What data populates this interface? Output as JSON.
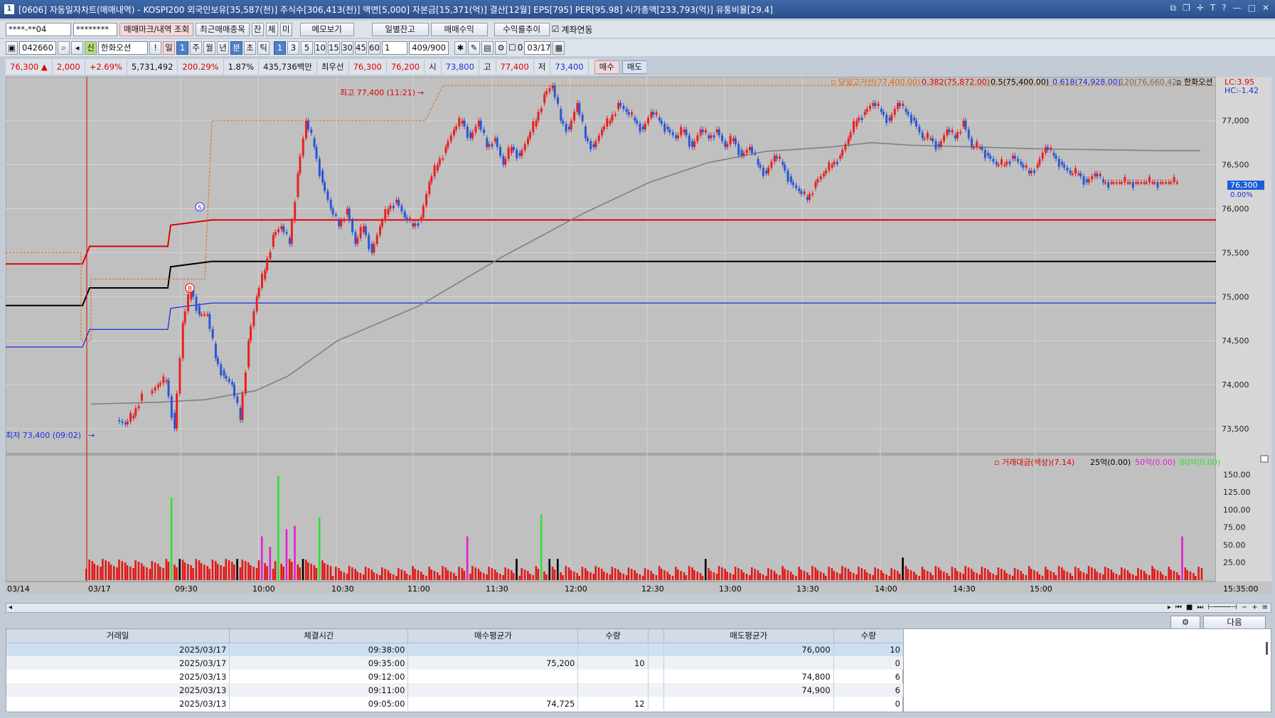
{
  "window": {
    "num": "1",
    "title": "[0606] 자동일자차트(매매내역) - KOSPI200 외국인보유[35,587(천)] 주식수[306,413(천)] 액면[5,000] 자본금[15,371(억)] 결산[12월] EPS[795] PER[95.98] 시가총액[233,793(억)] 유통비율[29.4]"
  },
  "toolbar1": {
    "account": "****-**04",
    "password": "********",
    "btn_mark": "매매마크/내역 조회",
    "btn_recent": "최근매매종목",
    "btn_jan": "잔",
    "btn_che": "체",
    "btn_mi": "미",
    "btn_memo": "메모보기",
    "btn_daily": "일별잔고",
    "btn_profit": "매매수익",
    "btn_profit_trend": "수익률추이",
    "chk_link": "계좌연동"
  },
  "toolbar2": {
    "code": "042660",
    "stock_badge": "신",
    "stock": "한화오션",
    "periods": [
      "일",
      "1",
      "주",
      "월",
      "년",
      "분",
      "초",
      "틱"
    ],
    "minutes": [
      "1",
      "3",
      "5",
      "10",
      "15",
      "30",
      "45",
      "60"
    ],
    "num": "1",
    "count": "409/900",
    "date": "03/17",
    "chk_zero": "0"
  },
  "pricebar": {
    "price": "76,300",
    "arrow": "▲",
    "change": "2,000",
    "rate": "+2.69%",
    "volume": "5,731,492",
    "vol_ratio": "200.29%",
    "turnover": "1.87%",
    "amount": "435,736백만",
    "pref": "최우선",
    "ask": "76,300",
    "bid": "76,200",
    "open_lbl": "시",
    "open": "73,800",
    "high_lbl": "고",
    "high": "77,400",
    "low_lbl": "저",
    "low": "73,400",
    "buy": "매수",
    "sell": "매도"
  },
  "legend": {
    "items": [
      "당일고가선(77,400.00)",
      "0.382(75,872.00)",
      "0.5(75,400.00)",
      "0.618(74,928.00)",
      "120(76,660.42)",
      "한화오션"
    ],
    "lc": "LC:3.95",
    "hc": "HC:-1.42"
  },
  "annotations": {
    "high": "최고 77,400 (11:21)",
    "low": "최저 73,400 (09:02)",
    "sell_mark": "S",
    "buy_mark": "B"
  },
  "price_axis": [
    "77,000",
    "76,500",
    "76,000",
    "75,500",
    "75,000",
    "74,500",
    "74,000",
    "73,500"
  ],
  "current_price": "76,300",
  "current_pct": "0.00%",
  "vol_legend": [
    "거래대금(색상)(7.14)",
    "25억(0.00)",
    "50억(0.00)",
    "80억(0.00)"
  ],
  "vol_axis": [
    "150.00",
    "125.00",
    "100.00",
    "75.00",
    "50.00",
    "25.00"
  ],
  "time_axis": [
    "03/14",
    "03/17",
    "09:30",
    "10:00",
    "10:30",
    "11:00",
    "11:30",
    "12:00",
    "12:30",
    "13:00",
    "13:30",
    "14:00",
    "14:30",
    "15:00",
    "15:35:00"
  ],
  "colors": {
    "up": "#e82020",
    "down": "#2b55d4",
    "ma": "#808080",
    "fib382": "#e00000",
    "fib5": "#000000",
    "fib618": "#1c2ee0",
    "high_line": "#e06a10",
    "vol_red": "#e01818",
    "vol_black": "#000000",
    "vol_magenta": "#e020d0",
    "vol_green": "#30e030"
  },
  "chart_data": {
    "type": "candlestick",
    "ylim": [
      73250,
      77450
    ],
    "fib_lines": {
      "hi": 77400,
      "f382": 75872,
      "f5": 75400,
      "f618": 74928,
      "lo": 73400
    },
    "ma120_points": [
      [
        0,
        73780
      ],
      [
        8,
        73800
      ],
      [
        14,
        73830
      ],
      [
        18,
        73900
      ],
      [
        20,
        73930
      ],
      [
        24,
        74100
      ],
      [
        30,
        74500
      ],
      [
        40,
        74900
      ],
      [
        50,
        75450
      ],
      [
        60,
        75950
      ],
      [
        68,
        76300
      ],
      [
        75,
        76520
      ],
      [
        82,
        76650
      ],
      [
        90,
        76700
      ],
      [
        95,
        76750
      ],
      [
        100,
        76720
      ],
      [
        108,
        76700
      ],
      [
        115,
        76680
      ],
      [
        122,
        76670
      ],
      [
        130,
        76660
      ],
      [
        135,
        76660
      ]
    ],
    "close_path": [
      [
        0,
        73600
      ],
      [
        4,
        73550
      ],
      [
        5,
        73650
      ],
      [
        6,
        73900
      ],
      [
        8,
        74000
      ],
      [
        9,
        74050
      ],
      [
        10,
        73500
      ],
      [
        11,
        74700
      ],
      [
        12,
        75100
      ],
      [
        13,
        74800
      ],
      [
        14,
        74800
      ],
      [
        15,
        74300
      ],
      [
        16,
        74100
      ],
      [
        17,
        74000
      ],
      [
        18,
        73600
      ],
      [
        19,
        74500
      ],
      [
        20,
        75000
      ],
      [
        21,
        75300
      ],
      [
        22,
        75700
      ],
      [
        23,
        75800
      ],
      [
        24,
        75600
      ],
      [
        25,
        76400
      ],
      [
        26,
        77000
      ],
      [
        27,
        76700
      ],
      [
        28,
        76300
      ],
      [
        29,
        76000
      ],
      [
        30,
        75800
      ],
      [
        31,
        76000
      ],
      [
        32,
        75600
      ],
      [
        33,
        75800
      ],
      [
        34,
        75500
      ],
      [
        35,
        75800
      ],
      [
        36,
        76000
      ],
      [
        37,
        76100
      ],
      [
        38,
        75900
      ],
      [
        39,
        75800
      ],
      [
        40,
        75900
      ],
      [
        41,
        76300
      ],
      [
        42,
        76500
      ],
      [
        43,
        76700
      ],
      [
        44,
        76900
      ],
      [
        45,
        77000
      ],
      [
        46,
        76800
      ],
      [
        47,
        77000
      ],
      [
        48,
        76700
      ],
      [
        49,
        76800
      ],
      [
        50,
        76500
      ],
      [
        51,
        76700
      ],
      [
        52,
        76600
      ],
      [
        53,
        76800
      ],
      [
        54,
        77000
      ],
      [
        55,
        77300
      ],
      [
        56,
        77400
      ],
      [
        57,
        77000
      ],
      [
        58,
        76900
      ],
      [
        59,
        77200
      ],
      [
        60,
        76800
      ],
      [
        61,
        76700
      ],
      [
        62,
        76900
      ],
      [
        63,
        77000
      ],
      [
        64,
        77200
      ],
      [
        65,
        77100
      ],
      [
        66,
        77000
      ],
      [
        67,
        76900
      ],
      [
        68,
        77100
      ],
      [
        69,
        77000
      ],
      [
        70,
        76900
      ],
      [
        71,
        76800
      ],
      [
        72,
        76900
      ],
      [
        73,
        76700
      ],
      [
        74,
        76900
      ],
      [
        75,
        76800
      ],
      [
        76,
        76900
      ],
      [
        77,
        76700
      ],
      [
        78,
        76800
      ],
      [
        79,
        76600
      ],
      [
        80,
        76700
      ],
      [
        81,
        76500
      ],
      [
        82,
        76400
      ],
      [
        83,
        76600
      ],
      [
        84,
        76500
      ],
      [
        85,
        76300
      ],
      [
        86,
        76200
      ],
      [
        87,
        76100
      ],
      [
        88,
        76300
      ],
      [
        89,
        76400
      ],
      [
        90,
        76500
      ],
      [
        91,
        76600
      ],
      [
        92,
        76800
      ],
      [
        93,
        77000
      ],
      [
        94,
        77100
      ],
      [
        95,
        77200
      ],
      [
        96,
        77100
      ],
      [
        97,
        77000
      ],
      [
        98,
        77200
      ],
      [
        99,
        77100
      ],
      [
        100,
        77000
      ],
      [
        101,
        76800
      ],
      [
        102,
        76800
      ],
      [
        103,
        76700
      ],
      [
        104,
        76900
      ],
      [
        105,
        76800
      ],
      [
        106,
        77000
      ],
      [
        107,
        76700
      ],
      [
        108,
        76700
      ],
      [
        109,
        76600
      ],
      [
        110,
        76500
      ],
      [
        111,
        76500
      ],
      [
        112,
        76600
      ],
      [
        113,
        76500
      ],
      [
        114,
        76400
      ],
      [
        115,
        76500
      ],
      [
        116,
        76700
      ],
      [
        117,
        76600
      ],
      [
        118,
        76500
      ],
      [
        119,
        76400
      ],
      [
        120,
        76400
      ],
      [
        121,
        76300
      ],
      [
        122,
        76400
      ],
      [
        123,
        76300
      ],
      [
        124,
        76300
      ],
      [
        125,
        76300
      ],
      [
        126,
        76300
      ],
      [
        127,
        76300
      ],
      [
        128,
        76300
      ],
      [
        129,
        76300
      ],
      [
        130,
        76300
      ],
      [
        131,
        76300
      ],
      [
        132,
        76300
      ]
    ],
    "vol_spikes": [
      [
        10,
        "vol_green",
        117
      ],
      [
        11,
        "vol_black",
        30
      ],
      [
        18,
        "vol_black",
        30
      ],
      [
        21,
        "vol_magenta",
        62
      ],
      [
        22,
        "vol_magenta",
        47
      ],
      [
        23,
        "vol_green",
        148
      ],
      [
        24,
        "vol_magenta",
        72
      ],
      [
        25,
        "vol_magenta",
        77
      ],
      [
        26,
        "vol_black",
        30
      ],
      [
        28,
        "vol_green",
        89
      ],
      [
        46,
        "vol_magenta",
        62
      ],
      [
        52,
        "vol_black",
        30
      ],
      [
        55,
        "vol_green",
        93
      ],
      [
        56,
        "vol_black",
        30
      ],
      [
        57,
        "vol_black",
        30
      ],
      [
        75,
        "vol_black",
        30
      ],
      [
        99,
        "vol_black",
        32
      ],
      [
        133,
        "vol_magenta",
        62
      ]
    ]
  },
  "table": {
    "headers": [
      "거래일",
      "체결시간",
      "매수평균가",
      "수량",
      "",
      "매도평균가",
      "수량"
    ],
    "rows": [
      [
        "2025/03/17",
        "09:38:00",
        "",
        "",
        "",
        "76,000",
        "10"
      ],
      [
        "2025/03/17",
        "09:35:00",
        "75,200",
        "10",
        "",
        "",
        "0"
      ],
      [
        "2025/03/13",
        "09:12:00",
        "",
        "",
        "",
        "74,800",
        "6"
      ],
      [
        "2025/03/13",
        "09:11:00",
        "",
        "",
        "",
        "74,900",
        "6"
      ],
      [
        "2025/03/13",
        "09:05:00",
        "74,725",
        "12",
        "",
        "",
        "0"
      ]
    ]
  },
  "next_btn": "다음"
}
